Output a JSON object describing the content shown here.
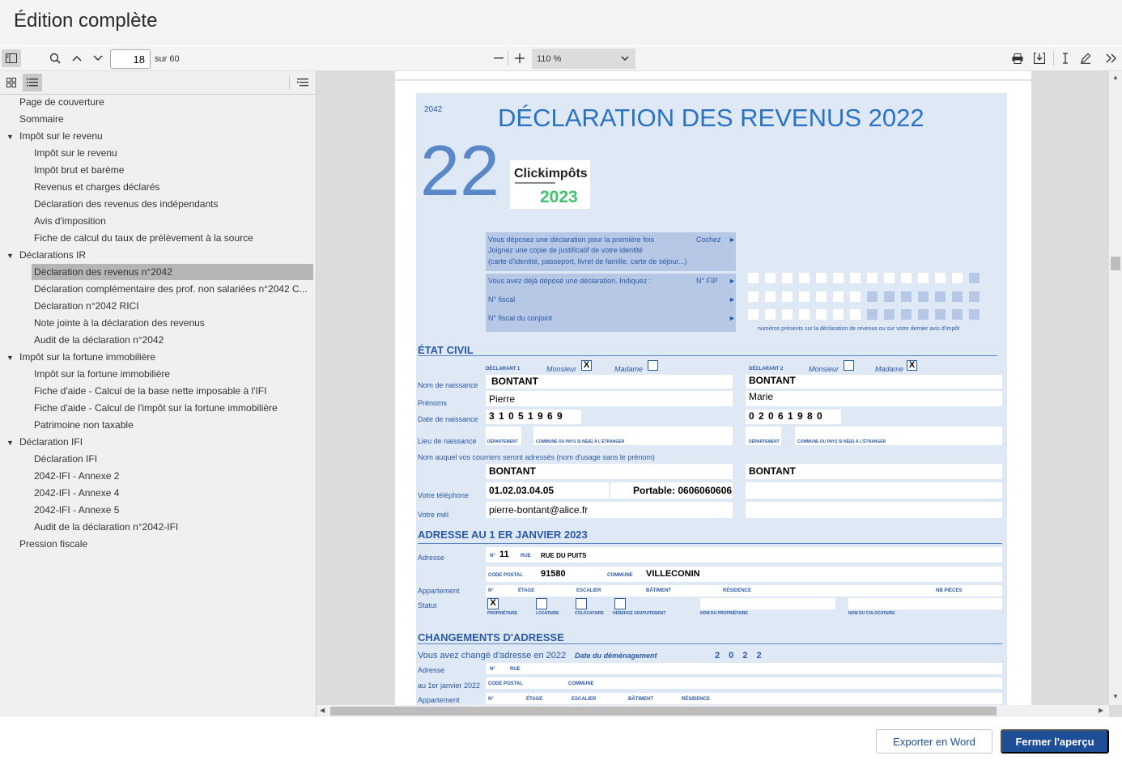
{
  "window": {
    "title": "Édition complète"
  },
  "toolbar": {
    "page_current": "18",
    "page_total": "sur 60",
    "zoom_value": "110 %",
    "zoom_out": "−",
    "zoom_in": "+"
  },
  "sidebar": {
    "items": [
      {
        "label": "Page de couverture",
        "level": 0,
        "expandable": false
      },
      {
        "label": "Sommaire",
        "level": 0,
        "expandable": false
      },
      {
        "label": "Impôt sur le revenu",
        "level": 0,
        "expandable": true
      },
      {
        "label": "Impôt sur le revenu",
        "level": 1
      },
      {
        "label": "Impôt brut et barème",
        "level": 1
      },
      {
        "label": "Revenus et charges déclarés",
        "level": 1
      },
      {
        "label": "Déclaration des revenus des indépendants",
        "level": 1
      },
      {
        "label": "Avis d'imposition",
        "level": 1
      },
      {
        "label": "Fiche de calcul du taux de prélèvement à la source",
        "level": 1
      },
      {
        "label": "Déclarations IR",
        "level": 0,
        "expandable": true
      },
      {
        "label": "Déclaration des revenus n°2042",
        "level": 1,
        "selected": true
      },
      {
        "label": "Déclaration complémentaire des prof. non salariées n°2042 C...",
        "level": 1
      },
      {
        "label": "Déclaration n°2042 RICI",
        "level": 1
      },
      {
        "label": "Note jointe à la déclaration des revenus",
        "level": 1
      },
      {
        "label": "Audit de la déclaration n°2042",
        "level": 1
      },
      {
        "label": "Impôt sur la fortune immobilière",
        "level": 0,
        "expandable": true
      },
      {
        "label": "Impôt sur la fortune immobilière",
        "level": 1
      },
      {
        "label": "Fiche d'aide - Calcul de la base nette imposable à l'IFI",
        "level": 1
      },
      {
        "label": "Fiche d'aide - Calcul de l'impôt sur la fortune immobilière",
        "level": 1
      },
      {
        "label": "Patrimoine non taxable",
        "level": 1
      },
      {
        "label": "Déclaration IFI",
        "level": 0,
        "expandable": true
      },
      {
        "label": "Déclaration IFI",
        "level": 1
      },
      {
        "label": "2042-IFI - Annexe 2",
        "level": 1
      },
      {
        "label": "2042-IFI - Annexe 4",
        "level": 1
      },
      {
        "label": "2042-IFI - Annexe 5",
        "level": 1
      },
      {
        "label": "Audit de la déclaration n°2042-IFI",
        "level": 1
      },
      {
        "label": "Pression fiscale",
        "level": 0,
        "expandable": false
      }
    ]
  },
  "document": {
    "form_code": "2042",
    "title": "DÉCLARATION DES REVENUS 2022",
    "big_number": "22",
    "logo_brand": "Clickimpôts",
    "logo_year": "2023",
    "first_time": {
      "line1": "Vous déposez une déclaration pour la première fois",
      "line2": "Joignez une copie de justificatif de votre identité",
      "line3": "(carte d'identité, passeport, livret de famille, carte de séjour...)",
      "cochez": "Cochez"
    },
    "already": {
      "line": "Vous avez déjà déposé une déclaration. Indiquez :",
      "nfip": "N° FIP",
      "nfiscal": "N° fiscal",
      "nfiscal_conjoint": "N° fiscal du conjoint",
      "note": "numéros présents sur la déclaration de revenus ou sur votre dernier avis d'impôt"
    },
    "etat_civil": {
      "heading": "ÉTAT CIVIL",
      "declarant1": "DÉCLARANT 1",
      "declarant2": "DÉCLARANT 2",
      "monsieur": "Monsieur",
      "madame": "Madame",
      "check_x": "X",
      "nom_naissance_label": "Nom de naissance",
      "prenoms_label": "Prénoms",
      "date_naissance_label": "Date de naissance",
      "lieu_naissance_label": "Lieu de naissance",
      "departement": "DÉPARTEMENT",
      "commune_etranger": "COMMUNE OU PAYS SI NÉ(E) À L'ÉTRANGER",
      "nom_usage_label": "Nom auquel vos courriers seront adressés (nom d'usage sans le prénom)",
      "telephone_label": "Votre téléphone",
      "mel_label": "Votre mél",
      "d1": {
        "nom": "BONTANT",
        "prenom": "Pierre",
        "date": "3 1 0 5 1 9 6 9",
        "nom_usage": "BONTANT",
        "telephone": "01.02.03.04.05",
        "portable": "Portable: 0606060606",
        "mel": "pierre-bontant@alice.fr"
      },
      "d2": {
        "nom": "BONTANT",
        "prenom": "Marie",
        "date": "0 2 0 6 1 9 8 0",
        "nom_usage": "BONTANT"
      }
    },
    "adresse": {
      "heading": "ADRESSE AU 1 ER JANVIER 2023",
      "adresse_label": "Adresse",
      "no_label": "N°",
      "numero": "11",
      "rue_label": "RUE",
      "rue": "RUE DU PUITS",
      "code_postal_label": "CODE POSTAL",
      "code_postal": "91580",
      "commune_label": "COMMUNE",
      "commune": "VILLECONIN",
      "appartement_label": "Appartement",
      "statut_label": "Statut",
      "apt_no": "N°",
      "etage": "ÉTAGE",
      "escalier": "ESCALIER",
      "batiment": "BÂTIMENT",
      "residence": "RÉSIDENCE",
      "nb_pieces": "NB PIÈCES",
      "proprietaire": "PROPRIÉTAIRE",
      "locataire": "LOCATAIRE",
      "colocataire": "COLOCATAIRE",
      "heberge": "HÉBERGÉ GRATUITEMENT",
      "nom_proprietaire": "NOM DU PROPRIÉTAIRE",
      "nom_colocataire": "NOM DU COLOCATAIRE"
    },
    "changement": {
      "heading": "CHANGEMENTS D'ADRESSE",
      "line": "Vous avez changé d'adresse en 2022",
      "date_label": "Date du déménagement",
      "date_value": "2 0 2 2",
      "adresse_label": "Adresse",
      "au_label": "au 1er janvier 2022",
      "appartement_label": "Appartement",
      "no": "N°",
      "rue": "RUE",
      "code_postal": "CODE POSTAL",
      "commune": "COMMUNE",
      "etage": "ÉTAGE",
      "escalier": "ESCALIER",
      "batiment": "BÂTIMENT",
      "residence": "RÉSIDENCE"
    }
  },
  "footer": {
    "export_label": "Exporter en Word",
    "close_label": "Fermer l'aperçu"
  }
}
